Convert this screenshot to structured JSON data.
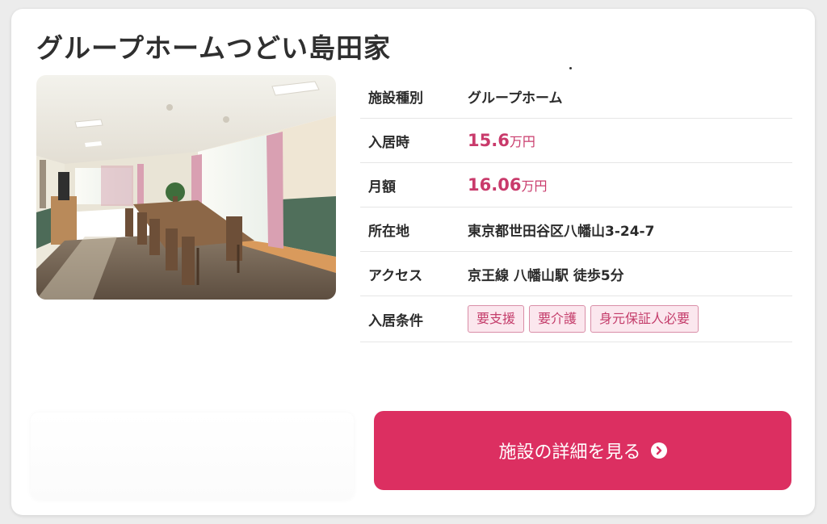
{
  "facility": {
    "name": "グループホームつどい島田家"
  },
  "photo": {
    "icon": "dining-room-photo"
  },
  "details": {
    "type": {
      "label": "施設種別",
      "value": "グループホーム"
    },
    "move_in": {
      "label": "入居時",
      "amount": "15.6",
      "unit": "万円"
    },
    "monthly": {
      "label": "月額",
      "amount": "16.06",
      "unit": "万円"
    },
    "address": {
      "label": "所在地",
      "value": "東京都世田谷区八幡山3-24-7"
    },
    "access": {
      "label": "アクセス",
      "value": "京王線 八幡山駅 徒歩5分"
    },
    "conditions": {
      "label": "入居条件",
      "tags": [
        "要支援",
        "要介護",
        "身元保証人必要"
      ]
    }
  },
  "cta": {
    "label": "施設の詳細を見る",
    "icon": "chevron-circle-right-icon"
  },
  "colors": {
    "accent": "#dc2f61",
    "price": "#c93a6b",
    "tag_bg": "#fbe7ee",
    "tag_border": "#d98ea7"
  }
}
